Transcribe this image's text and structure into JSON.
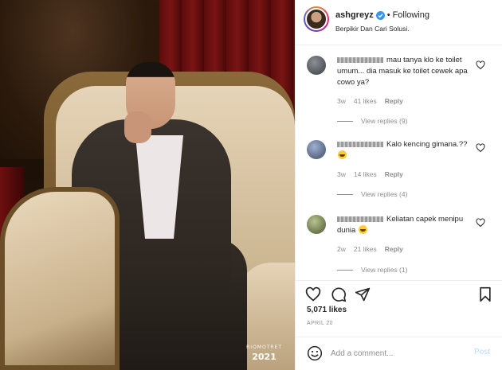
{
  "post": {
    "photo_brand": "RIOMOTRET",
    "photo_year": "2021"
  },
  "header": {
    "username": "ashgreyz",
    "separator": "•",
    "follow_state": "Following",
    "bio": "Berpikir Dan Cari Solusi."
  },
  "comments": [
    {
      "text_line": "mau tanya klo ke toilet umum... dia masuk ke toilet cewek apa cowo ya?",
      "time": "3w",
      "likes": "41 likes",
      "reply": "Reply",
      "view_replies": "View replies (9)",
      "has_emoji": false,
      "avatar_color": "#4a4f55"
    },
    {
      "text_line": "Kalo kencing gimana.??",
      "time": "3w",
      "likes": "14 likes",
      "reply": "Reply",
      "view_replies": "View replies (4)",
      "has_emoji": true,
      "avatar_color": "#5a6a8c"
    },
    {
      "text_line": "Keliatan capek menipu dunia",
      "time": "2w",
      "likes": "21 likes",
      "reply": "Reply",
      "view_replies": "View replies (1)",
      "has_emoji": true,
      "avatar_color": "#6b7a4a"
    }
  ],
  "actions": {
    "icons": [
      "heart-icon",
      "comment-icon",
      "share-icon",
      "bookmark-icon"
    ]
  },
  "likes_count": "5,071 likes",
  "date": "APRIL 20",
  "comment_box": {
    "placeholder": "Add a comment...",
    "post_label": "Post"
  },
  "colors": {
    "verified": "#3897f0",
    "post_button_disabled": "#b2dffc",
    "meta_text": "#8e8e8e"
  }
}
